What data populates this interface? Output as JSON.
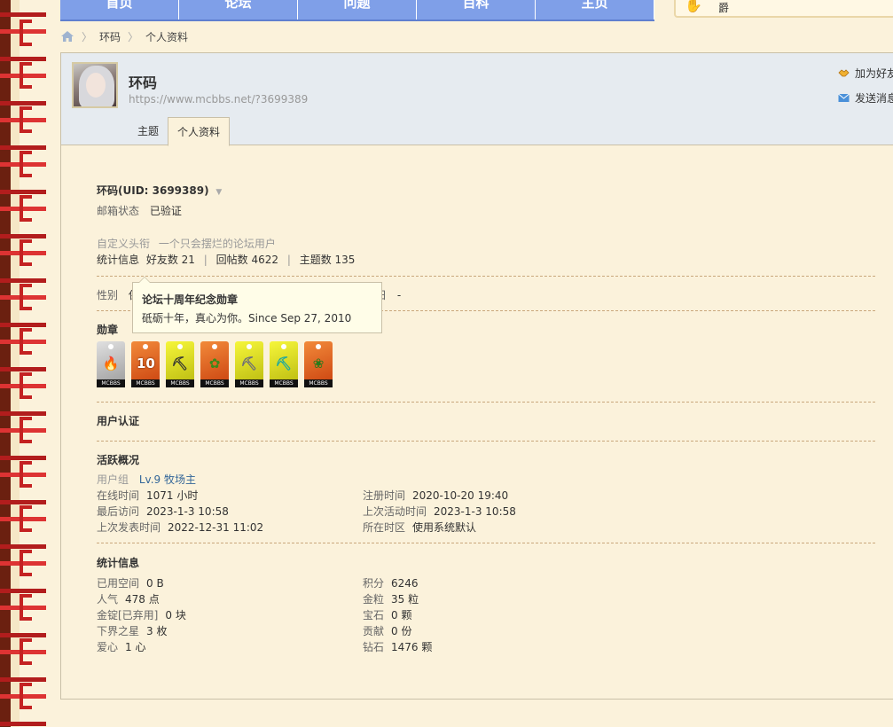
{
  "nav": {
    "items": [
      "首页",
      "论坛",
      "问题",
      "百科",
      "主页"
    ]
  },
  "topright_text": "爵",
  "breadcrumb": {
    "items": [
      "环码",
      "个人资料"
    ]
  },
  "header": {
    "username": "环码",
    "url": "https://www.mcbbs.net/?3699389",
    "actions": [
      "加为好友",
      "发送消息"
    ],
    "tabs": [
      "主题",
      "个人资料"
    ]
  },
  "profile": {
    "uid_line": "环码(UID: 3699389)",
    "email_label": "邮箱状态",
    "email_value": "已验证",
    "title_label": "自定义头衔",
    "title_value": "一个只会摆烂的论坛用户",
    "stats_label": "统计信息",
    "stats": [
      "好友数 21",
      "回帖数 4622",
      "主题数 135"
    ],
    "gender_label": "性别",
    "gender_value": "保",
    "extra_label": "日",
    "extra_value": "-",
    "medals_label": "勋章",
    "medals": [
      {
        "name": "medal-1",
        "color": "#b8b8b8",
        "symbol": "🔥"
      },
      {
        "name": "medal-2",
        "color": "#e86a1e",
        "symbol": "10"
      },
      {
        "name": "medal-3",
        "color": "#e8e81e",
        "symbol": "⛏"
      },
      {
        "name": "medal-4",
        "color": "#e86a1e",
        "symbol": "✿"
      },
      {
        "name": "medal-5",
        "color": "#e8e81e",
        "symbol": "⛏"
      },
      {
        "name": "medal-6",
        "color": "#e8e81e",
        "symbol": "⛏"
      },
      {
        "name": "medal-7",
        "color": "#e86a1e",
        "symbol": "❀"
      }
    ],
    "medal_tag": "MCBBS",
    "tooltip": {
      "title": "论坛十周年纪念勋章",
      "desc": "砥砺十年，真心为你。Since Sep 27, 2010"
    },
    "verify_title": "用户认证",
    "activity_title": "活跃概况",
    "group_label": "用户组",
    "group_value": "Lv.9 牧场主",
    "activity": [
      {
        "label": "在线时间",
        "value": "1071 小时"
      },
      {
        "label": "注册时间",
        "value": "2020-10-20 19:40"
      },
      {
        "label": "最后访问",
        "value": "2023-1-3 10:58"
      },
      {
        "label": "上次活动时间",
        "value": "2023-1-3 10:58"
      },
      {
        "label": "上次发表时间",
        "value": "2022-12-31 11:02"
      },
      {
        "label": "所在时区",
        "value": "使用系统默认"
      }
    ],
    "statinfo_title": "统计信息",
    "statinfo": [
      {
        "label": "已用空间",
        "value": "0 B"
      },
      {
        "label": "积分",
        "value": "6246"
      },
      {
        "label": "人气",
        "value": "478 点"
      },
      {
        "label": "金粒",
        "value": "35 粒"
      },
      {
        "label": "金锭[已弃用]",
        "value": "0 块"
      },
      {
        "label": "宝石",
        "value": "0 颗"
      },
      {
        "label": "下界之星",
        "value": "3 枚"
      },
      {
        "label": "贡献",
        "value": "0 份"
      },
      {
        "label": "爱心",
        "value": "1 心"
      },
      {
        "label": "钻石",
        "value": "1476 颗"
      }
    ]
  }
}
